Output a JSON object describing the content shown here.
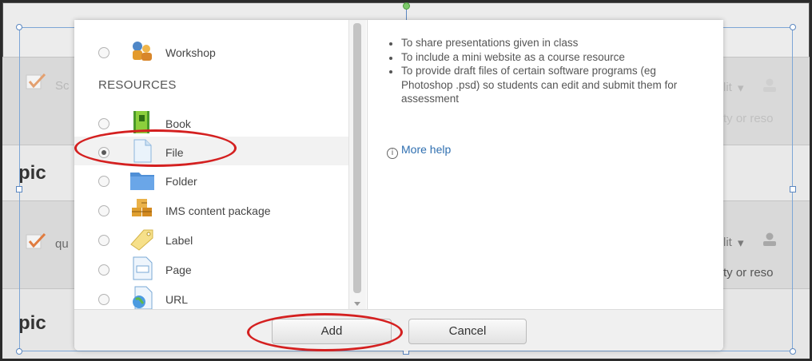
{
  "background": {
    "topic_partial_1": "pic",
    "topic_partial_2": "pic",
    "activity_partial_1": "Sc",
    "activity_partial_2": "qu",
    "edit_partial_1": "lit",
    "edit_partial_2": "lit",
    "resource_partial_1": "ty or reso",
    "resource_partial_2": "ty or reso",
    "edit_caret": "▾"
  },
  "chooser": {
    "section_resources": "RESOURCES",
    "items": [
      {
        "label": "Workshop",
        "icon": "workshop-icon",
        "selected": false
      },
      {
        "label": "Book",
        "icon": "book-icon",
        "selected": false
      },
      {
        "label": "File",
        "icon": "file-icon",
        "selected": true
      },
      {
        "label": "Folder",
        "icon": "folder-icon",
        "selected": false
      },
      {
        "label": "IMS content package",
        "icon": "ims-package-icon",
        "selected": false
      },
      {
        "label": "Label",
        "icon": "label-icon",
        "selected": false
      },
      {
        "label": "Page",
        "icon": "page-icon",
        "selected": false
      },
      {
        "label": "URL",
        "icon": "url-icon",
        "selected": false
      }
    ]
  },
  "help": {
    "bullets": [
      "To share presentations given in class",
      "To include a mini website as a course resource",
      "To provide draft files of certain software programs (eg Photoshop .psd) so students can edit and submit them for assessment"
    ],
    "more_help": "More help",
    "more_help_icon": "i"
  },
  "footer": {
    "add_label": "Add",
    "cancel_label": "Cancel"
  },
  "colors": {
    "annotation_red": "#d42020",
    "link_blue": "#2f6fb0"
  }
}
